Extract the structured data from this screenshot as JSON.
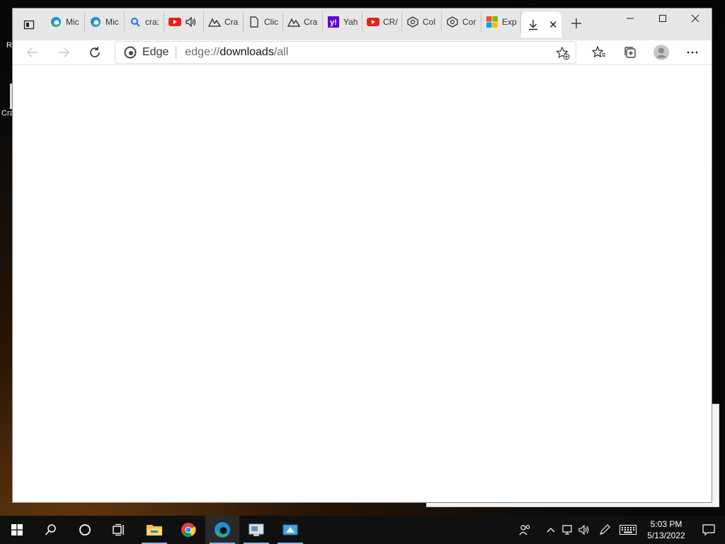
{
  "desktop": {
    "icon1_label": "R",
    "icon2_label": "Cra"
  },
  "browser": {
    "tabs": [
      {
        "label": "Mic",
        "icon": "edge-icon"
      },
      {
        "label": "Mic",
        "icon": "edge-icon"
      },
      {
        "label": "cra:",
        "icon": "search-icon"
      },
      {
        "label": "",
        "icon": "youtube-icon"
      },
      {
        "label": "Cra",
        "icon": "app-icon"
      },
      {
        "label": "Clic",
        "icon": "page-icon"
      },
      {
        "label": "Cra",
        "icon": "app-icon"
      },
      {
        "label": "Yah",
        "icon": "yahoo-icon"
      },
      {
        "label": "CR/",
        "icon": "youtube-icon"
      },
      {
        "label": "Col",
        "icon": "cube-icon"
      },
      {
        "label": "Cor",
        "icon": "cube-icon"
      },
      {
        "label": "Exp",
        "icon": "microsoft-icon"
      }
    ],
    "active_tab_icon": "download-icon",
    "address": {
      "site_label": "Edge",
      "url_scheme": "edge://",
      "url_host": "downloads",
      "url_path": "/all"
    }
  },
  "taskbar": {
    "apps": [
      "start",
      "search",
      "cortana",
      "task-view",
      "file-explorer",
      "chrome",
      "edge",
      "app",
      "app"
    ],
    "time": "5:03 PM",
    "date": "5/13/2022"
  },
  "colors": {
    "tabbar_bg": "#e6e6e6",
    "taskbar_bg": "#101010",
    "edge_blue": "#1f8ed6",
    "youtube_red": "#e62117",
    "yahoo_purple": "#5f01d1"
  }
}
